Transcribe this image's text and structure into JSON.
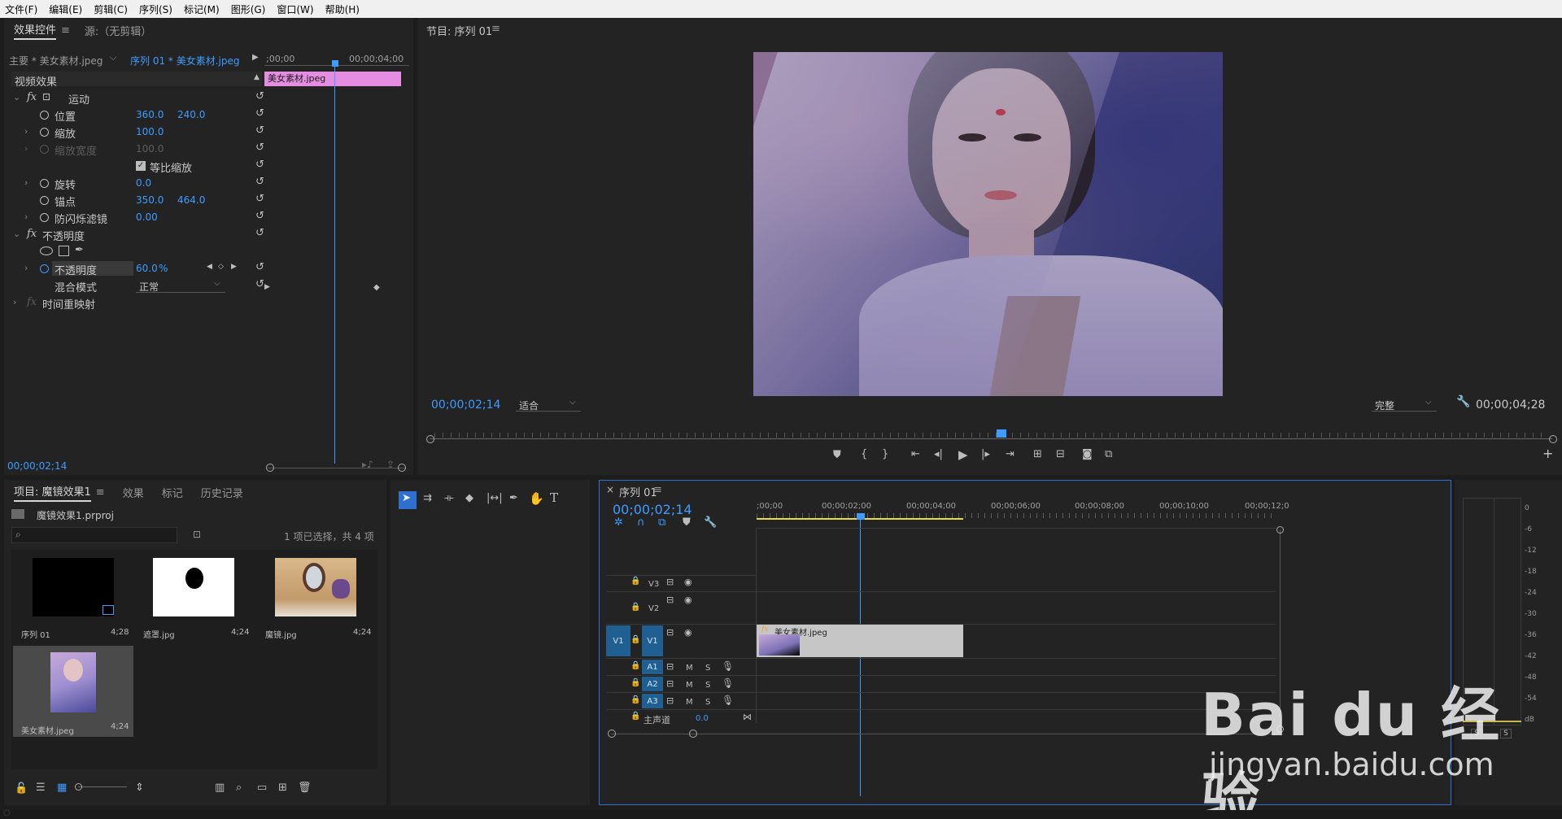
{
  "menubar": {
    "items": [
      "文件(F)",
      "编辑(E)",
      "剪辑(C)",
      "序列(S)",
      "标记(M)",
      "图形(G)",
      "窗口(W)",
      "帮助(H)"
    ]
  },
  "effect_controls": {
    "tab_active": "效果控件",
    "tab_source": "源:（无剪辑）",
    "master_label": "主要 * 美女素材.jpeg",
    "sequence_label": "序列 01 * 美女素材.jpeg",
    "ruler_start": ";00;00",
    "ruler_end": "00;00;04;00",
    "clip_bar_label": "美女素材.jpeg",
    "section_video": "视频效果",
    "motion": "运动",
    "position_label": "位置",
    "position_x": "360.0",
    "position_y": "240.0",
    "scale_label": "缩放",
    "scale_value": "100.0",
    "scale_width_label": "缩放宽度",
    "scale_width_value": "100.0",
    "uniform_scale": "等比缩放",
    "rotation_label": "旋转",
    "rotation_value": "0.0",
    "anchor_label": "锚点",
    "anchor_x": "350.0",
    "anchor_y": "464.0",
    "antiflicker_label": "防闪烁滤镜",
    "antiflicker_value": "0.00",
    "opacity_section": "不透明度",
    "opacity_label": "不透明度",
    "opacity_value": "60.0",
    "opacity_unit": "%",
    "blend_label": "混合模式",
    "blend_value": "正常",
    "time_remap": "时间重映射",
    "timecode": "00;00;02;14"
  },
  "program": {
    "title": "节目: 序列 01",
    "timecode_current": "00;00;02;14",
    "fit_label": "适合",
    "quality_label": "完整",
    "timecode_duration": "00;00;04;28"
  },
  "project": {
    "tabs": [
      "项目: 魔镜效果1",
      "效果",
      "标记",
      "历史记录"
    ],
    "project_file": "魔镜效果1.prproj",
    "selection_info": "1 项已选择，共 4 项",
    "items": [
      {
        "name": "序列 01",
        "duration": "4;28"
      },
      {
        "name": "遮罩.jpg",
        "duration": "4;24"
      },
      {
        "name": "魔镜.jpg",
        "duration": "4;24"
      },
      {
        "name": "美女素材.jpeg",
        "duration": "4;24"
      }
    ]
  },
  "timeline": {
    "title": "序列 01",
    "timecode": "00;00;02;14",
    "ruler_labels": [
      ";00;00",
      "00;00;02;00",
      "00;00;04;00",
      "00;00;06;00",
      "00;00;08;00",
      "00;00;10;00",
      "00;00;12;0"
    ],
    "video_tracks": [
      "V3",
      "V2",
      "V1"
    ],
    "audio_tracks": [
      "A1",
      "A2",
      "A3"
    ],
    "master_label": "主声道",
    "master_value": "0.0",
    "clip_label": "美女素材.jpeg",
    "source_patch": "V1",
    "m_label": "M",
    "s_label": "S"
  },
  "meter": {
    "scale": [
      "0",
      "-6",
      "-12",
      "-18",
      "-24",
      "-30",
      "-36",
      "-42",
      "-48",
      "-54",
      "dB"
    ],
    "solo_labels": [
      "S",
      "S"
    ]
  },
  "watermark": {
    "logo": "Bai du 经验",
    "url": "jingyan.baidu.com"
  },
  "colors": {
    "accent_blue": "#3e9cff",
    "clip_pink": "#e58de0",
    "track_blue": "#1f5f92",
    "playhead": "#3e9cff",
    "work_area_yellow": "#e8d84a"
  }
}
